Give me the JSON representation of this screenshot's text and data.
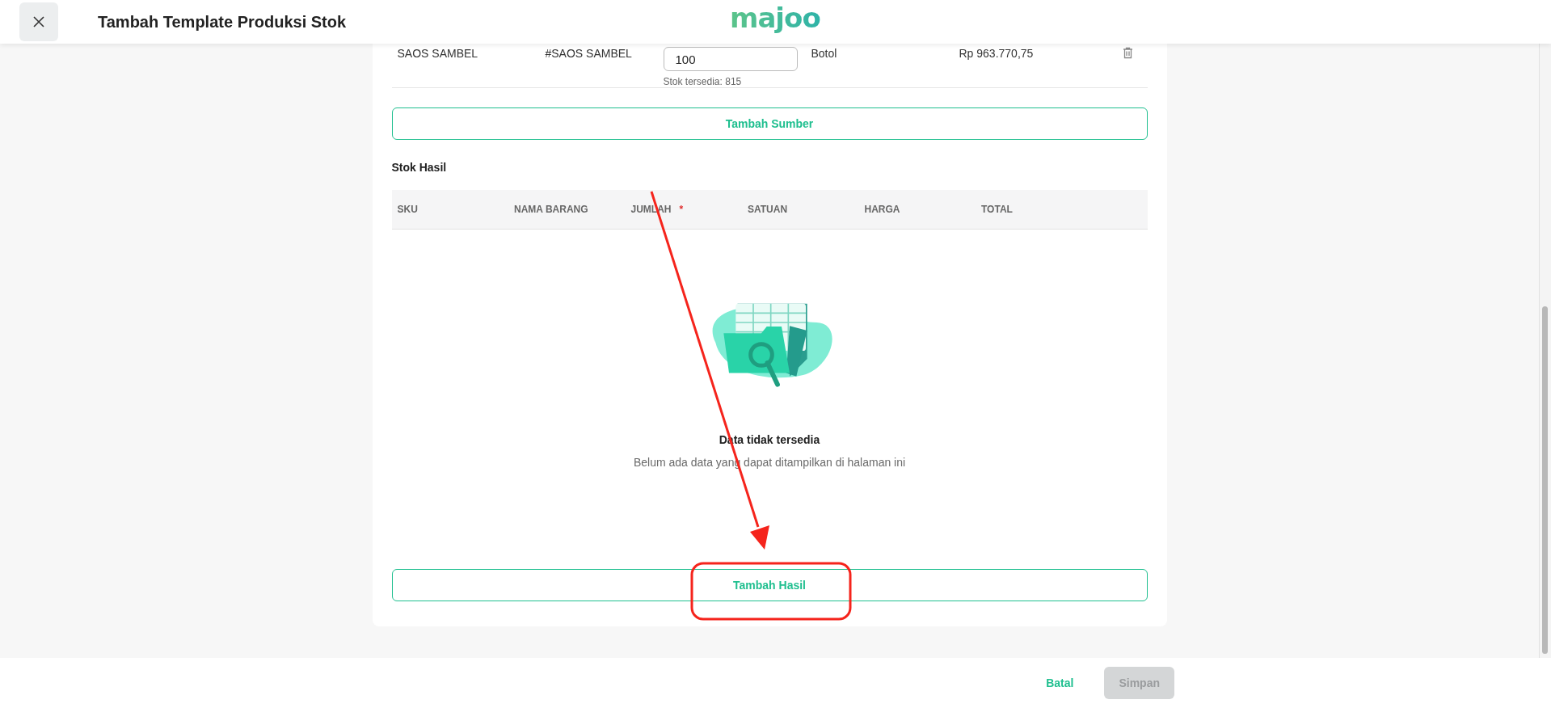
{
  "header": {
    "title": "Tambah Template Produksi Stok",
    "logo": "majoo"
  },
  "source_row": {
    "name": "SAOS SAMBEL",
    "sku": "#SAOS SAMBEL",
    "quantity": "100",
    "stock_hint": "Stok tersedia: 815",
    "unit": "Botol",
    "price": "Rp 963.770,75"
  },
  "add_source_button": "Tambah Sumber",
  "result_section": {
    "title": "Stok Hasil",
    "columns": [
      {
        "label": "SKU"
      },
      {
        "label": "NAMA BARANG"
      },
      {
        "label": "JUMLAH",
        "marker": "*"
      },
      {
        "label": "SATUAN"
      },
      {
        "label": "HARGA"
      },
      {
        "label": "TOTAL"
      }
    ],
    "empty_title": "Data tidak tersedia",
    "empty_message": "Belum ada data yang dapat ditampilkan di halaman ini",
    "add_button": "Tambah Hasil"
  },
  "footer": {
    "buttons": [
      {
        "label": "Batal",
        "kind": "link",
        "disabled": false
      },
      {
        "label": "Simpan",
        "kind": "primary",
        "disabled": true
      }
    ]
  }
}
